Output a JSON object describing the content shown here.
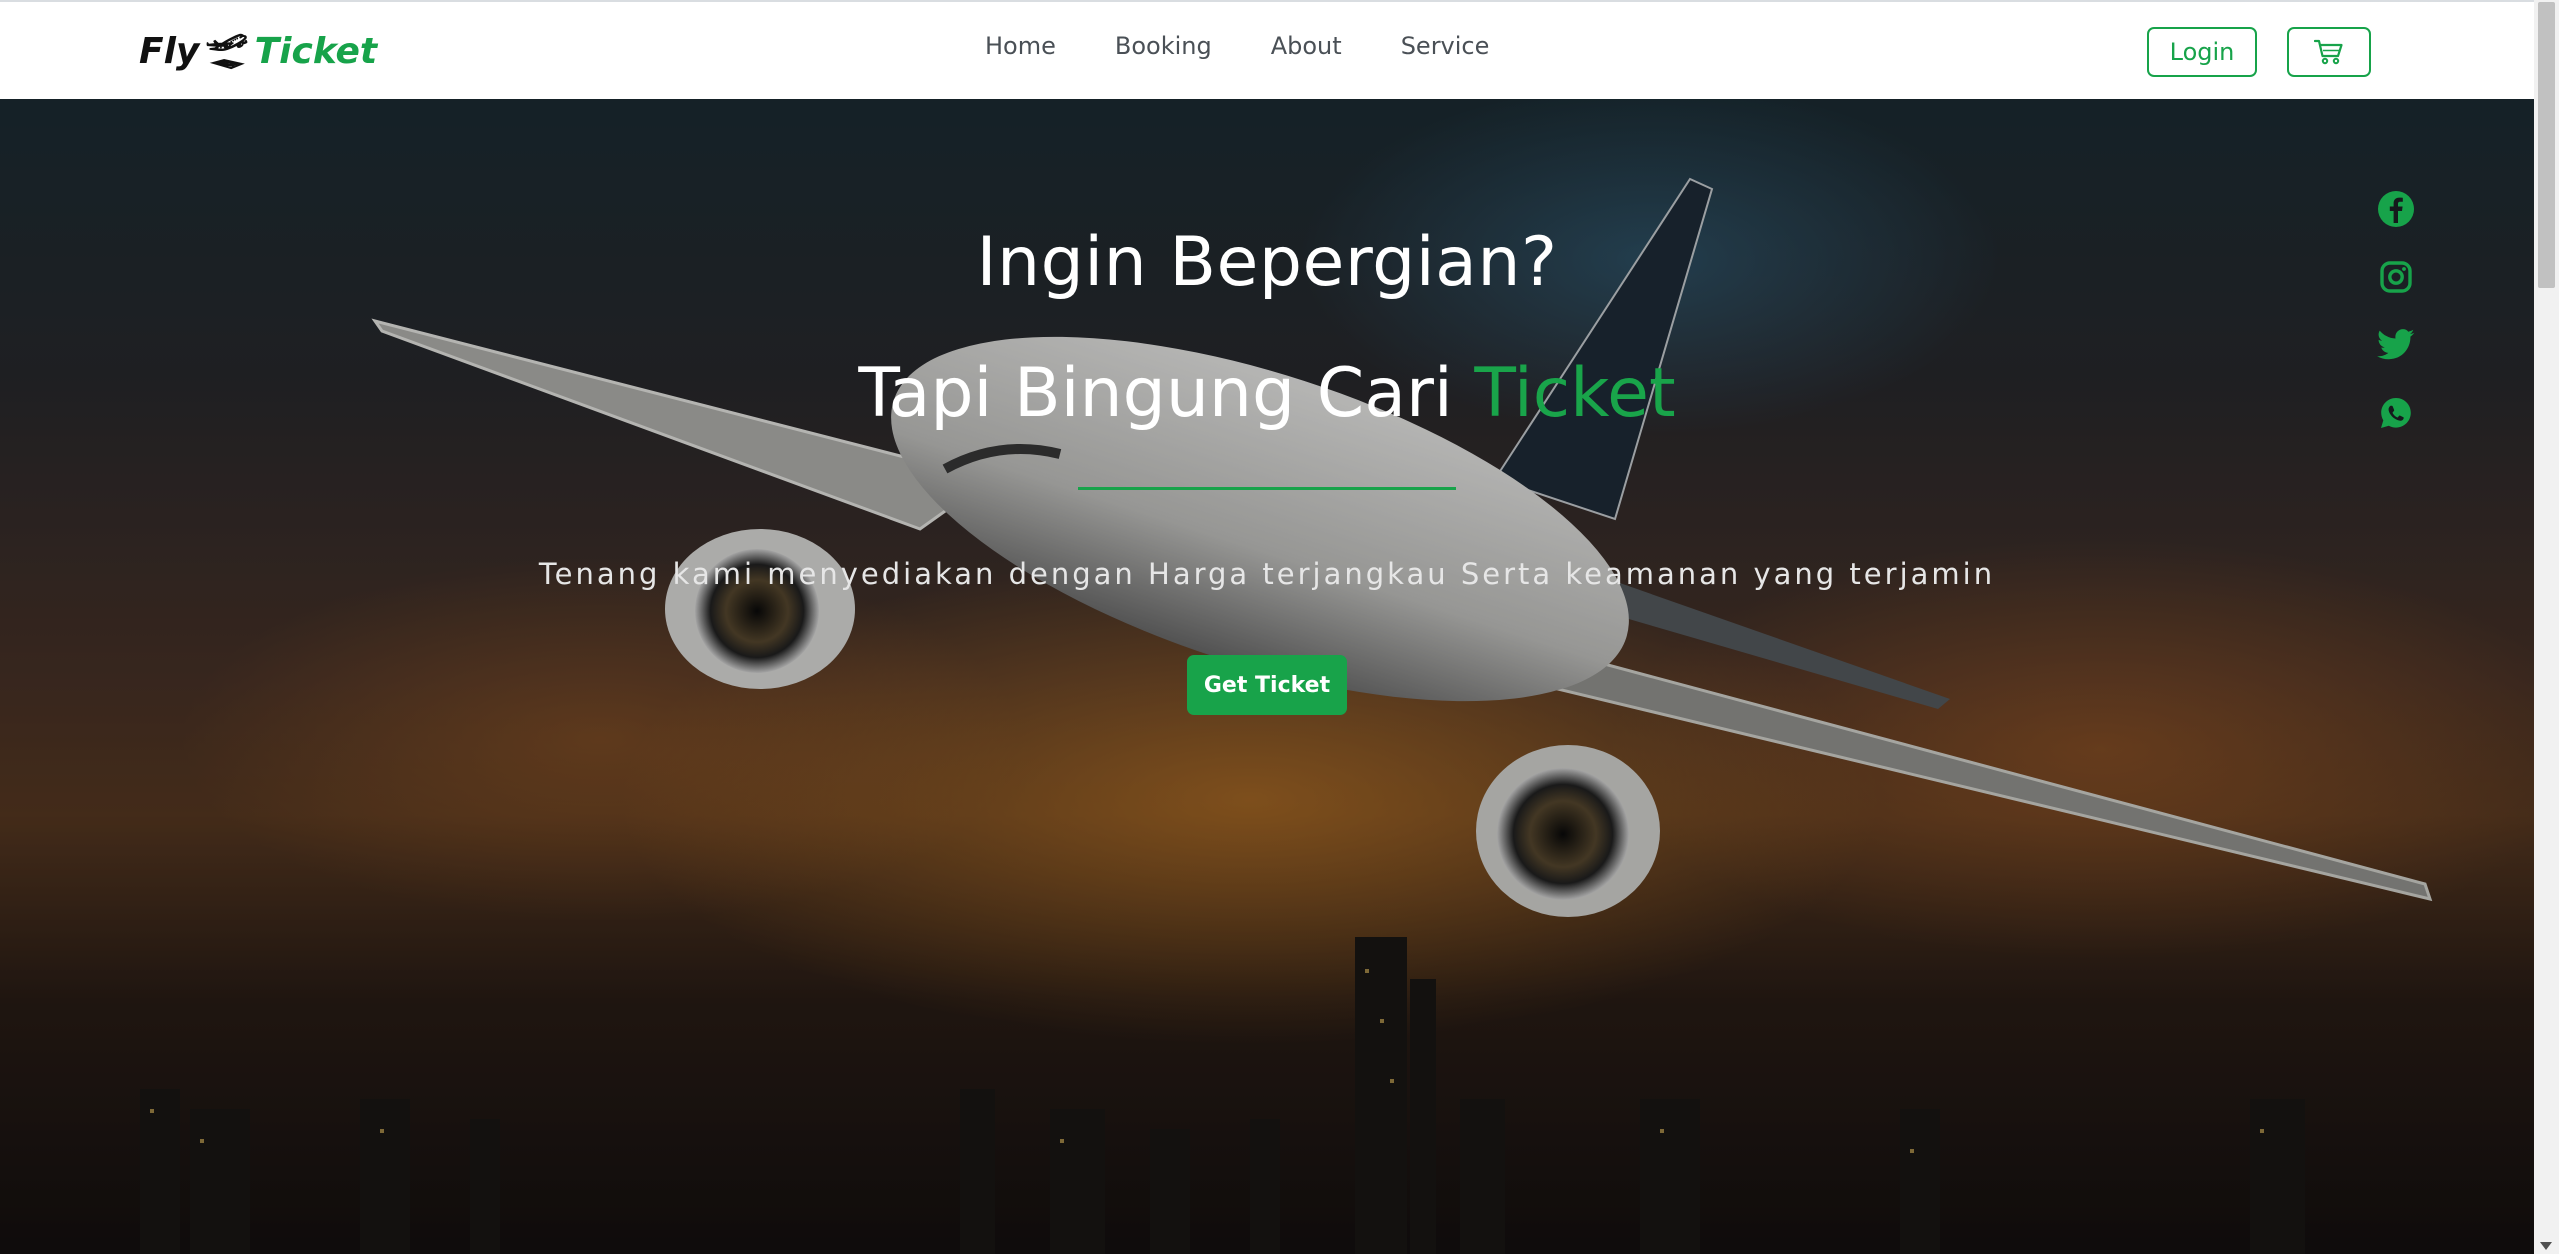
{
  "brand": {
    "part1": "Fly",
    "icon": "plane-departure-icon",
    "part2": "Ticket"
  },
  "nav": {
    "items": [
      {
        "label": "Home"
      },
      {
        "label": "Booking"
      },
      {
        "label": "About"
      },
      {
        "label": "Service"
      }
    ]
  },
  "header_actions": {
    "login_label": "Login",
    "cart_icon": "cart-icon"
  },
  "hero": {
    "title_line1": "Ingin Bepergian?",
    "title_line2_prefix": "Tapi Bingung Cari ",
    "title_line2_accent": "Ticket",
    "subtitle": "Tenang kami menyediakan dengan Harga terjangkau Serta keamanan yang terjamin",
    "cta_label": "Get Ticket"
  },
  "social": [
    "facebook-icon",
    "instagram-icon",
    "twitter-icon",
    "whatsapp-icon"
  ],
  "colors": {
    "accent": "#17a34a",
    "nav_text": "#4a5056",
    "hero_text": "#ffffff"
  }
}
